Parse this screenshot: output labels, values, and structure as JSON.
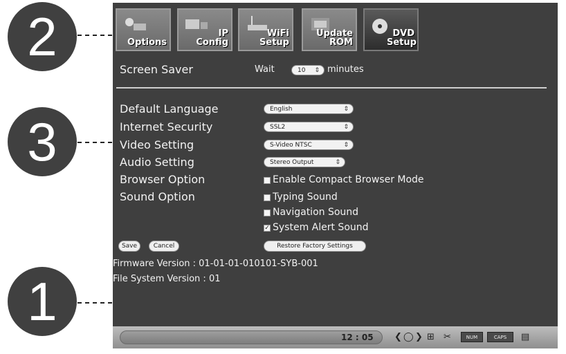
{
  "callouts": [
    "2",
    "3",
    "1"
  ],
  "toolbar": {
    "buttons": [
      {
        "label": "Options",
        "icon": "options-icon"
      },
      {
        "label": "IP Config",
        "icon": "ip-config-icon"
      },
      {
        "label": "WiFi Setup",
        "icon": "wifi-setup-icon"
      },
      {
        "label": "Update ROM",
        "icon": "update-rom-icon"
      },
      {
        "label": "DVD Setup",
        "icon": "dvd-icon"
      }
    ]
  },
  "screen_saver": {
    "label": "Screen Saver",
    "wait_label": "Wait",
    "value": "10",
    "unit": "minutes"
  },
  "settings": {
    "default_language": {
      "label": "Default Language",
      "value": "English"
    },
    "internet_security": {
      "label": "Internet Security",
      "value": "SSL2"
    },
    "video_setting": {
      "label": "Video Setting",
      "value": "S-Video NTSC"
    },
    "audio_setting": {
      "label": "Audio Setting",
      "value": "Stereo Output"
    },
    "browser_option": {
      "label": "Browser Option",
      "checkbox_label": "Enable Compact Browser Mode",
      "checked": false
    },
    "sound_option": {
      "label": "Sound Option",
      "items": [
        {
          "label": "Typing Sound",
          "checked": false
        },
        {
          "label": "Navigation Sound",
          "checked": false
        },
        {
          "label": "System Alert Sound",
          "checked": true
        }
      ]
    }
  },
  "actions": {
    "save": "Save",
    "cancel": "Cancel",
    "restore": "Restore Factory Settings"
  },
  "firmware_version": "Firmware Version : 01-01-01-010101-SYB-001",
  "file_system_version": "File System Version : 01",
  "taskbar": {
    "time": "12 : 05",
    "tray_labels": [
      "NUM",
      "CAPS"
    ]
  },
  "colors": {
    "screen_bg": "#3f3f3f",
    "callout_bg": "#404040",
    "taskbar_bg": "#a8a8a8"
  }
}
